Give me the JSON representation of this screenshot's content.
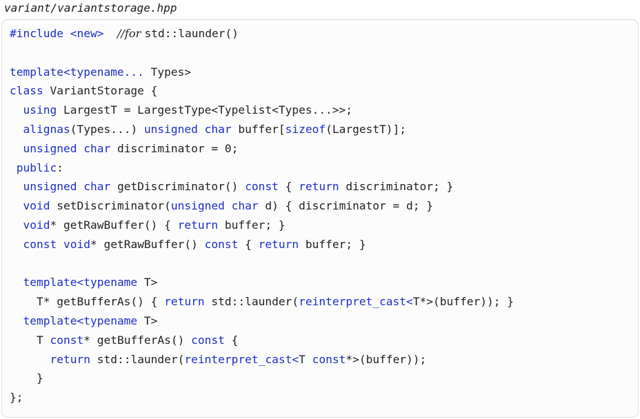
{
  "file": {
    "title": "variant/variantstorage.hpp"
  },
  "colors": {
    "keyword": "#1c2dc9",
    "text": "#1f1f1f",
    "box_border": "#dcdcdc",
    "box_background": "#fcfcfc"
  },
  "code": {
    "lines": [
      [
        {
          "t": "#include <new>",
          "k": "kw"
        },
        {
          "t": "  ",
          "k": "plain"
        },
        {
          "t": "//for ",
          "k": "comment"
        },
        {
          "t": "std::launder()",
          "k": "plain"
        }
      ],
      [],
      [
        {
          "t": "template<typename...",
          "k": "kw"
        },
        {
          "t": " Types>",
          "k": "plain"
        }
      ],
      [
        {
          "t": "class",
          "k": "kw"
        },
        {
          "t": " VariantStorage {",
          "k": "plain"
        }
      ],
      [
        {
          "t": "  ",
          "k": "plain"
        },
        {
          "t": "using",
          "k": "kw"
        },
        {
          "t": " LargestT = LargestType<Typelist<Types...>>;",
          "k": "plain"
        }
      ],
      [
        {
          "t": "  ",
          "k": "plain"
        },
        {
          "t": "alignas",
          "k": "kw"
        },
        {
          "t": "(Types...) ",
          "k": "plain"
        },
        {
          "t": "unsigned char",
          "k": "kw"
        },
        {
          "t": " buffer[",
          "k": "plain"
        },
        {
          "t": "sizeof",
          "k": "kw"
        },
        {
          "t": "(LargestT)];",
          "k": "plain"
        }
      ],
      [
        {
          "t": "  ",
          "k": "plain"
        },
        {
          "t": "unsigned char",
          "k": "kw"
        },
        {
          "t": " discriminator = 0;",
          "k": "plain"
        }
      ],
      [
        {
          "t": " ",
          "k": "plain"
        },
        {
          "t": "public",
          "k": "kw"
        },
        {
          "t": ":",
          "k": "plain"
        }
      ],
      [
        {
          "t": "  ",
          "k": "plain"
        },
        {
          "t": "unsigned char",
          "k": "kw"
        },
        {
          "t": " getDiscriminator() ",
          "k": "plain"
        },
        {
          "t": "const",
          "k": "kw"
        },
        {
          "t": " { ",
          "k": "plain"
        },
        {
          "t": "return",
          "k": "kw"
        },
        {
          "t": " discriminator; }",
          "k": "plain"
        }
      ],
      [
        {
          "t": "  ",
          "k": "plain"
        },
        {
          "t": "void",
          "k": "kw"
        },
        {
          "t": " setDiscriminator(",
          "k": "plain"
        },
        {
          "t": "unsigned char",
          "k": "kw"
        },
        {
          "t": " d) { discriminator = d; }",
          "k": "plain"
        }
      ],
      [
        {
          "t": "  ",
          "k": "plain"
        },
        {
          "t": "void",
          "k": "kw"
        },
        {
          "t": "* getRawBuffer() { ",
          "k": "plain"
        },
        {
          "t": "return",
          "k": "kw"
        },
        {
          "t": " buffer; }",
          "k": "plain"
        }
      ],
      [
        {
          "t": "  ",
          "k": "plain"
        },
        {
          "t": "const void",
          "k": "kw"
        },
        {
          "t": "* getRawBuffer() ",
          "k": "plain"
        },
        {
          "t": "const",
          "k": "kw"
        },
        {
          "t": " { ",
          "k": "plain"
        },
        {
          "t": "return",
          "k": "kw"
        },
        {
          "t": " buffer; }",
          "k": "plain"
        }
      ],
      [],
      [
        {
          "t": "  ",
          "k": "plain"
        },
        {
          "t": "template<typename",
          "k": "kw"
        },
        {
          "t": " T>",
          "k": "plain"
        }
      ],
      [
        {
          "t": "    T* getBufferAs() { ",
          "k": "plain"
        },
        {
          "t": "return",
          "k": "kw"
        },
        {
          "t": " std::launder(",
          "k": "plain"
        },
        {
          "t": "reinterpret_cast<",
          "k": "kw"
        },
        {
          "t": "T*>(buffer)); }",
          "k": "plain"
        }
      ],
      [
        {
          "t": "  ",
          "k": "plain"
        },
        {
          "t": "template<typename",
          "k": "kw"
        },
        {
          "t": " T>",
          "k": "plain"
        }
      ],
      [
        {
          "t": "    T ",
          "k": "plain"
        },
        {
          "t": "const",
          "k": "kw"
        },
        {
          "t": "* getBufferAs() ",
          "k": "plain"
        },
        {
          "t": "const",
          "k": "kw"
        },
        {
          "t": " {",
          "k": "plain"
        }
      ],
      [
        {
          "t": "      ",
          "k": "plain"
        },
        {
          "t": "return",
          "k": "kw"
        },
        {
          "t": " std::launder(",
          "k": "plain"
        },
        {
          "t": "reinterpret_cast<",
          "k": "kw"
        },
        {
          "t": "T ",
          "k": "plain"
        },
        {
          "t": "const",
          "k": "kw"
        },
        {
          "t": "*>(buffer));",
          "k": "plain"
        }
      ],
      [
        {
          "t": "    }",
          "k": "plain"
        }
      ],
      [
        {
          "t": "};",
          "k": "plain"
        }
      ]
    ]
  }
}
